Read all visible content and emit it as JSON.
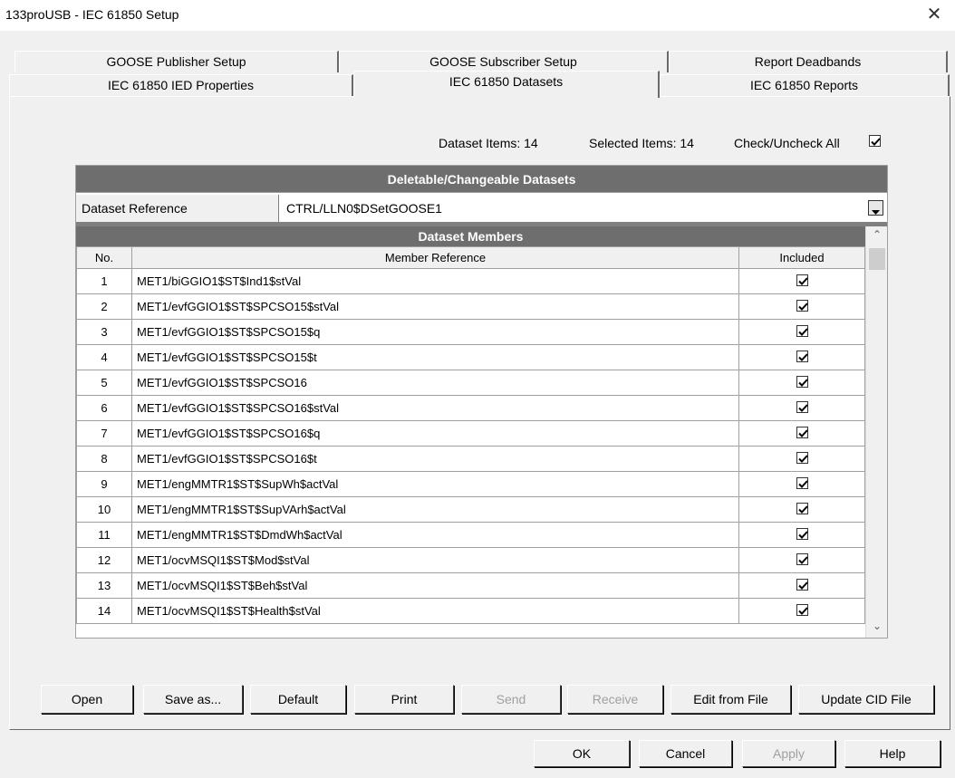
{
  "window": {
    "title": "133proUSB - IEC 61850 Setup"
  },
  "tabs_back": [
    "GOOSE Publisher Setup",
    "GOOSE Subscriber Setup",
    "Report Deadbands"
  ],
  "tabs_front": [
    "IEC 61850 IED Properties",
    "IEC 61850 Datasets",
    "IEC 61850 Reports"
  ],
  "info": {
    "dataset_items": "Dataset Items: 14",
    "selected_items": "Selected Items: 14",
    "check_all": "Check/Uncheck All"
  },
  "grid": {
    "section_title": "Deletable/Changeable Datasets",
    "ref_label": "Dataset Reference",
    "ref_value": "CTRL/LLN0$DSetGOOSE1",
    "members_title": "Dataset Members",
    "col_no": "No.",
    "col_member": "Member Reference",
    "col_included": "Included",
    "rows": [
      {
        "no": "1",
        "ref": "MET1/biGGIO1$ST$Ind1$stVal"
      },
      {
        "no": "2",
        "ref": "MET1/evfGGIO1$ST$SPCSO15$stVal"
      },
      {
        "no": "3",
        "ref": "MET1/evfGGIO1$ST$SPCSO15$q"
      },
      {
        "no": "4",
        "ref": "MET1/evfGGIO1$ST$SPCSO15$t"
      },
      {
        "no": "5",
        "ref": "MET1/evfGGIO1$ST$SPCSO16"
      },
      {
        "no": "6",
        "ref": "MET1/evfGGIO1$ST$SPCSO16$stVal"
      },
      {
        "no": "7",
        "ref": "MET1/evfGGIO1$ST$SPCSO16$q"
      },
      {
        "no": "8",
        "ref": "MET1/evfGGIO1$ST$SPCSO16$t"
      },
      {
        "no": "9",
        "ref": "MET1/engMMTR1$ST$SupWh$actVal"
      },
      {
        "no": "10",
        "ref": "MET1/engMMTR1$ST$SupVArh$actVal"
      },
      {
        "no": "11",
        "ref": "MET1/engMMTR1$ST$DmdWh$actVal"
      },
      {
        "no": "12",
        "ref": "MET1/ocvMSQI1$ST$Mod$stVal"
      },
      {
        "no": "13",
        "ref": "MET1/ocvMSQI1$ST$Beh$stVal"
      },
      {
        "no": "14",
        "ref": "MET1/ocvMSQI1$ST$Health$stVal"
      }
    ]
  },
  "buttons": {
    "open": "Open",
    "save_as": "Save as...",
    "default": "Default",
    "print": "Print",
    "send": "Send",
    "receive": "Receive",
    "edit_from_file": "Edit from File",
    "update_cid": "Update CID File"
  },
  "dialog": {
    "ok": "OK",
    "cancel": "Cancel",
    "apply": "Apply",
    "help": "Help"
  }
}
